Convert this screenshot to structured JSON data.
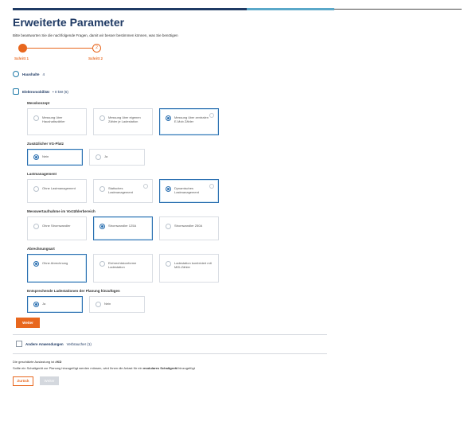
{
  "title": "Erweiterte Parameter",
  "subtitle": "Bitte beantworten Sie die nachfolgende Fragen, damit wir besser bestimmen können, was Sie benötigen",
  "stepper": {
    "step1": "Schritt 1",
    "step2": "Schritt 2",
    "step2_num": "2"
  },
  "haushalte": {
    "label": "Haushalte",
    "count": "4"
  },
  "elektro": {
    "label": "Elektromobilität",
    "meta": "• 0 kW (6)"
  },
  "sections": [
    {
      "title": "Messkonzept",
      "options": [
        "Messung über Haushaltszähler",
        "Messung über eigenen Zähler je Ladestation",
        "Messung über zentralen E-Mob Zähler"
      ]
    },
    {
      "title": "Zusätzlicher VG-Platz",
      "options": [
        "Nein",
        "Ja"
      ]
    },
    {
      "title": "Lastmanagement",
      "options": [
        "Ohne Lastmanagement",
        "Statisches Lastmanagement",
        "Dynamisches Lastmanagement"
      ]
    },
    {
      "title": "Messwertaufnahme im Vorzählerbereich",
      "options": [
        "Ohne Stromwandler",
        "Stromwandler 125A",
        "Stromwandler 250A"
      ]
    },
    {
      "title": "Abrechnungsart",
      "options": [
        "Ohne Abrechnung",
        "Eichrechtskonforme Ladestation",
        "Ladestation kombiniert mit MID-Zähler"
      ]
    },
    {
      "title": "Entsprechende Ladestationen der Planung hinzufügen",
      "options": [
        "Ja",
        "Nein"
      ]
    }
  ],
  "weiter": "Weiter",
  "andere": {
    "label": "Andere Anwendungen",
    "meta": "Verbraucher (1)"
  },
  "footer": {
    "line1_pre": "Die geschätzte Auslastung ist ",
    "line1_val": "#KD",
    "line2_pre": "Sollte ein Schaltgerät zur Planung hinzugefügt werden müssen, wird Ihnen die Anlast für ein ",
    "line2_bold": "modulares Schaltgerät",
    "line2_post": " hinzugefügt"
  },
  "zurueck": "Zurück",
  "next_disabled": "Weiter"
}
